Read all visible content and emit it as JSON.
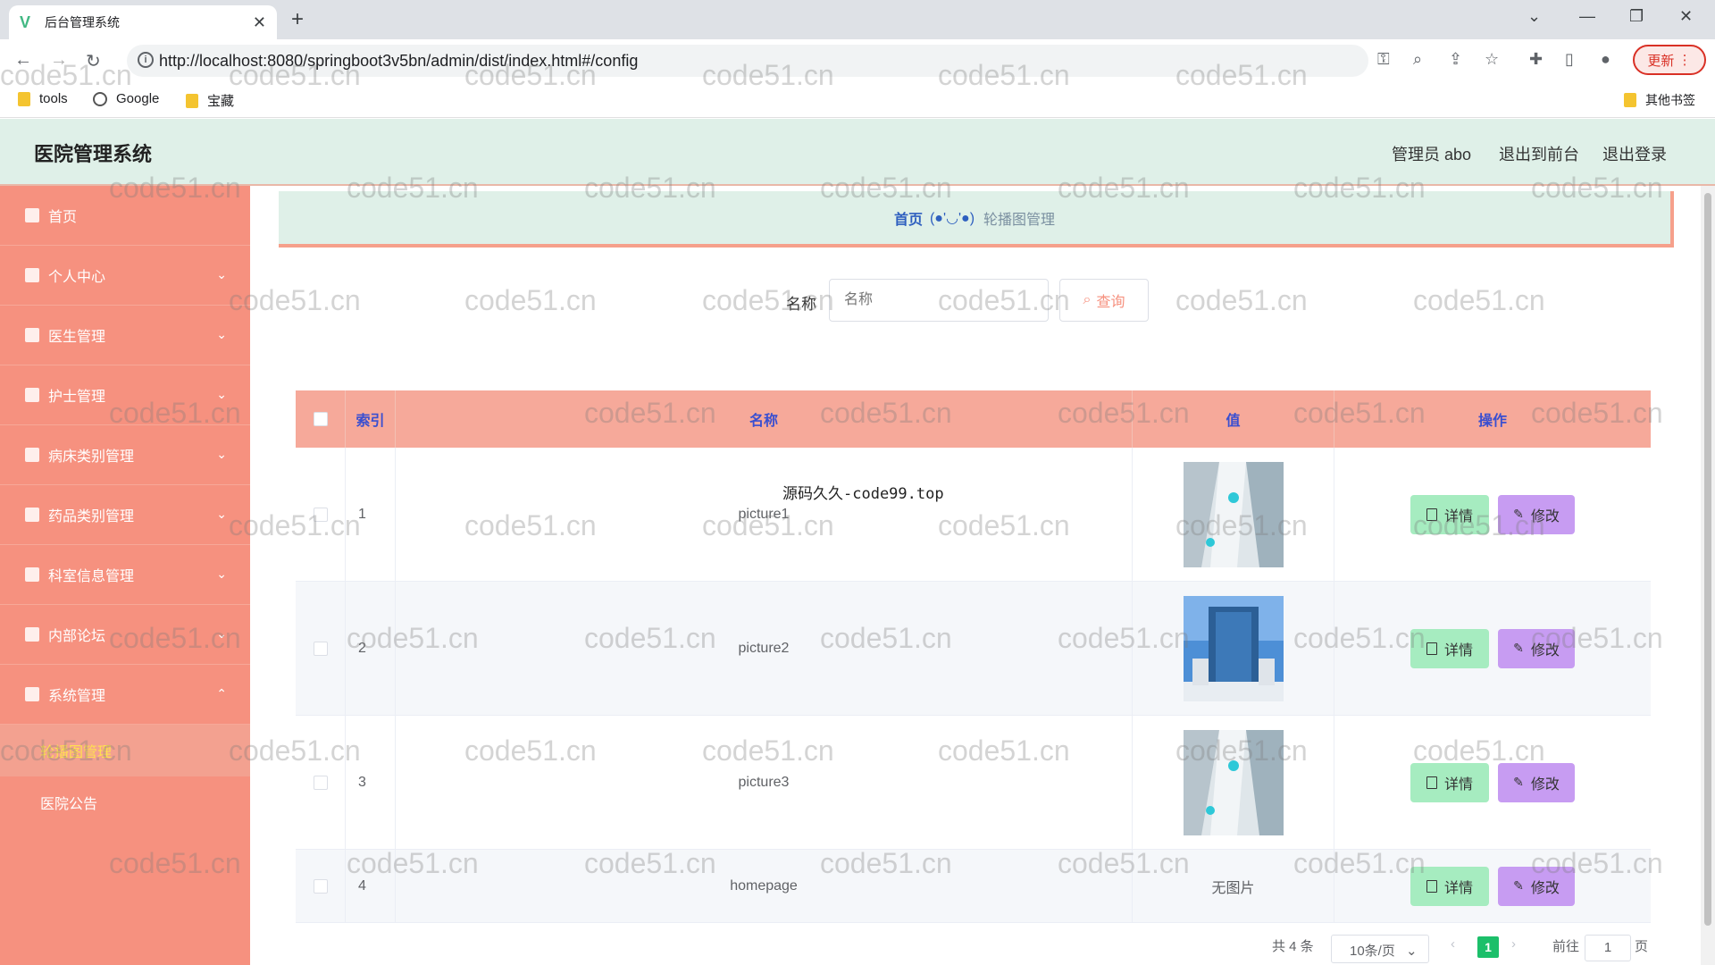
{
  "browser": {
    "tab_title": "后台管理系统",
    "url": "http://localhost:8080/springboot3v5bn/admin/dist/index.html#/config",
    "update_label": "更新",
    "bookmarks": [
      "tools",
      "Google",
      "宝藏"
    ],
    "other_bookmarks": "其他书签"
  },
  "header": {
    "title": "医院管理系统",
    "user_label": "管理员 abo",
    "front_link": "退出到前台",
    "logout_link": "退出登录"
  },
  "sidebar": {
    "items": [
      {
        "label": "首页",
        "icon": "home-icon"
      },
      {
        "label": "个人中心",
        "icon": "user-icon"
      },
      {
        "label": "医生管理",
        "icon": "briefcase-icon"
      },
      {
        "label": "护士管理",
        "icon": "clipboard-icon"
      },
      {
        "label": "病床类别管理",
        "icon": "bed-icon"
      },
      {
        "label": "药品类别管理",
        "icon": "box-icon"
      },
      {
        "label": "科室信息管理",
        "icon": "send-icon"
      },
      {
        "label": "内部论坛",
        "icon": "pin-icon"
      },
      {
        "label": "系统管理",
        "icon": "grid-icon"
      }
    ],
    "submenu": [
      {
        "label": "轮播图管理",
        "active": true
      },
      {
        "label": "医院公告",
        "active": false
      }
    ]
  },
  "breadcrumb": {
    "home": "首页",
    "separator": "(●'◡'●)",
    "current": "轮播图管理"
  },
  "search": {
    "label": "名称",
    "placeholder": "名称",
    "button": "查询"
  },
  "table": {
    "columns": [
      "索引",
      "名称",
      "值",
      "操作"
    ],
    "rows": [
      {
        "index": "1",
        "name": "picture1",
        "value": "image"
      },
      {
        "index": "2",
        "name": "picture2",
        "value": "image"
      },
      {
        "index": "3",
        "name": "picture3",
        "value": "image"
      },
      {
        "index": "4",
        "name": "homepage",
        "value": "无图片"
      }
    ],
    "detail_label": "详情",
    "edit_label": "修改"
  },
  "overlay_text": "源码久久-code99.top",
  "pagination": {
    "total": "共 4 条",
    "page_size": "10条/页",
    "current_page": "1",
    "goto_label": "前往",
    "goto_value": "1",
    "page_suffix": "页"
  },
  "watermark": "code51.cn",
  "colors": {
    "sidebar": "#f6917f",
    "header": "#dff0e8",
    "table_header": "#f6a99a",
    "detail_button": "#a6ecc0",
    "edit_button": "#c79cf2"
  }
}
